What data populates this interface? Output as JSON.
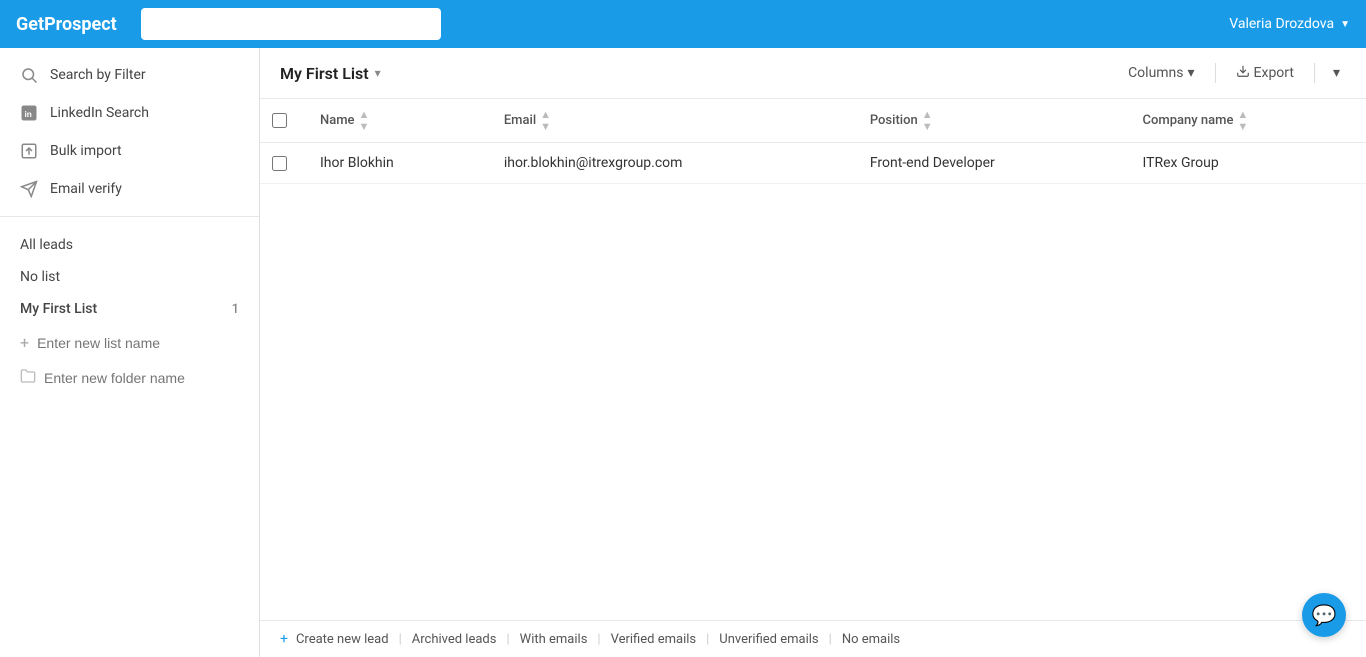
{
  "app": {
    "logo": "GetProspect",
    "search_placeholder": ""
  },
  "header": {
    "user_name": "Valeria Drozdova"
  },
  "sidebar": {
    "nav_items": [
      {
        "id": "search-by-filter",
        "label": "Search by Filter",
        "icon": "search"
      },
      {
        "id": "linkedin-search",
        "label": "LinkedIn Search",
        "icon": "linkedin"
      },
      {
        "id": "bulk-import",
        "label": "Bulk import",
        "icon": "upload"
      },
      {
        "id": "email-verify",
        "label": "Email verify",
        "icon": "paper-plane"
      }
    ],
    "all_leads_label": "All leads",
    "no_list_label": "No list",
    "my_first_list_label": "My First List",
    "my_first_list_count": "1",
    "add_list_placeholder": "Enter new list name",
    "add_folder_placeholder": "Enter new folder name"
  },
  "main": {
    "list_title": "My First List",
    "columns_label": "Columns",
    "export_label": "Export",
    "table": {
      "columns": [
        "Name",
        "Email",
        "Position",
        "Company name"
      ],
      "rows": [
        {
          "name": "Ihor Blokhin",
          "email": "ihor.blokhin@itrexgroup.com",
          "position": "Front-end Developer",
          "company": "ITRex Group"
        }
      ]
    },
    "footer": {
      "create_lead": "Create new lead",
      "archived_leads": "Archived leads",
      "with_emails": "With emails",
      "verified_emails": "Verified emails",
      "unverified_emails": "Unverified emails",
      "no_emails": "No emails"
    }
  }
}
